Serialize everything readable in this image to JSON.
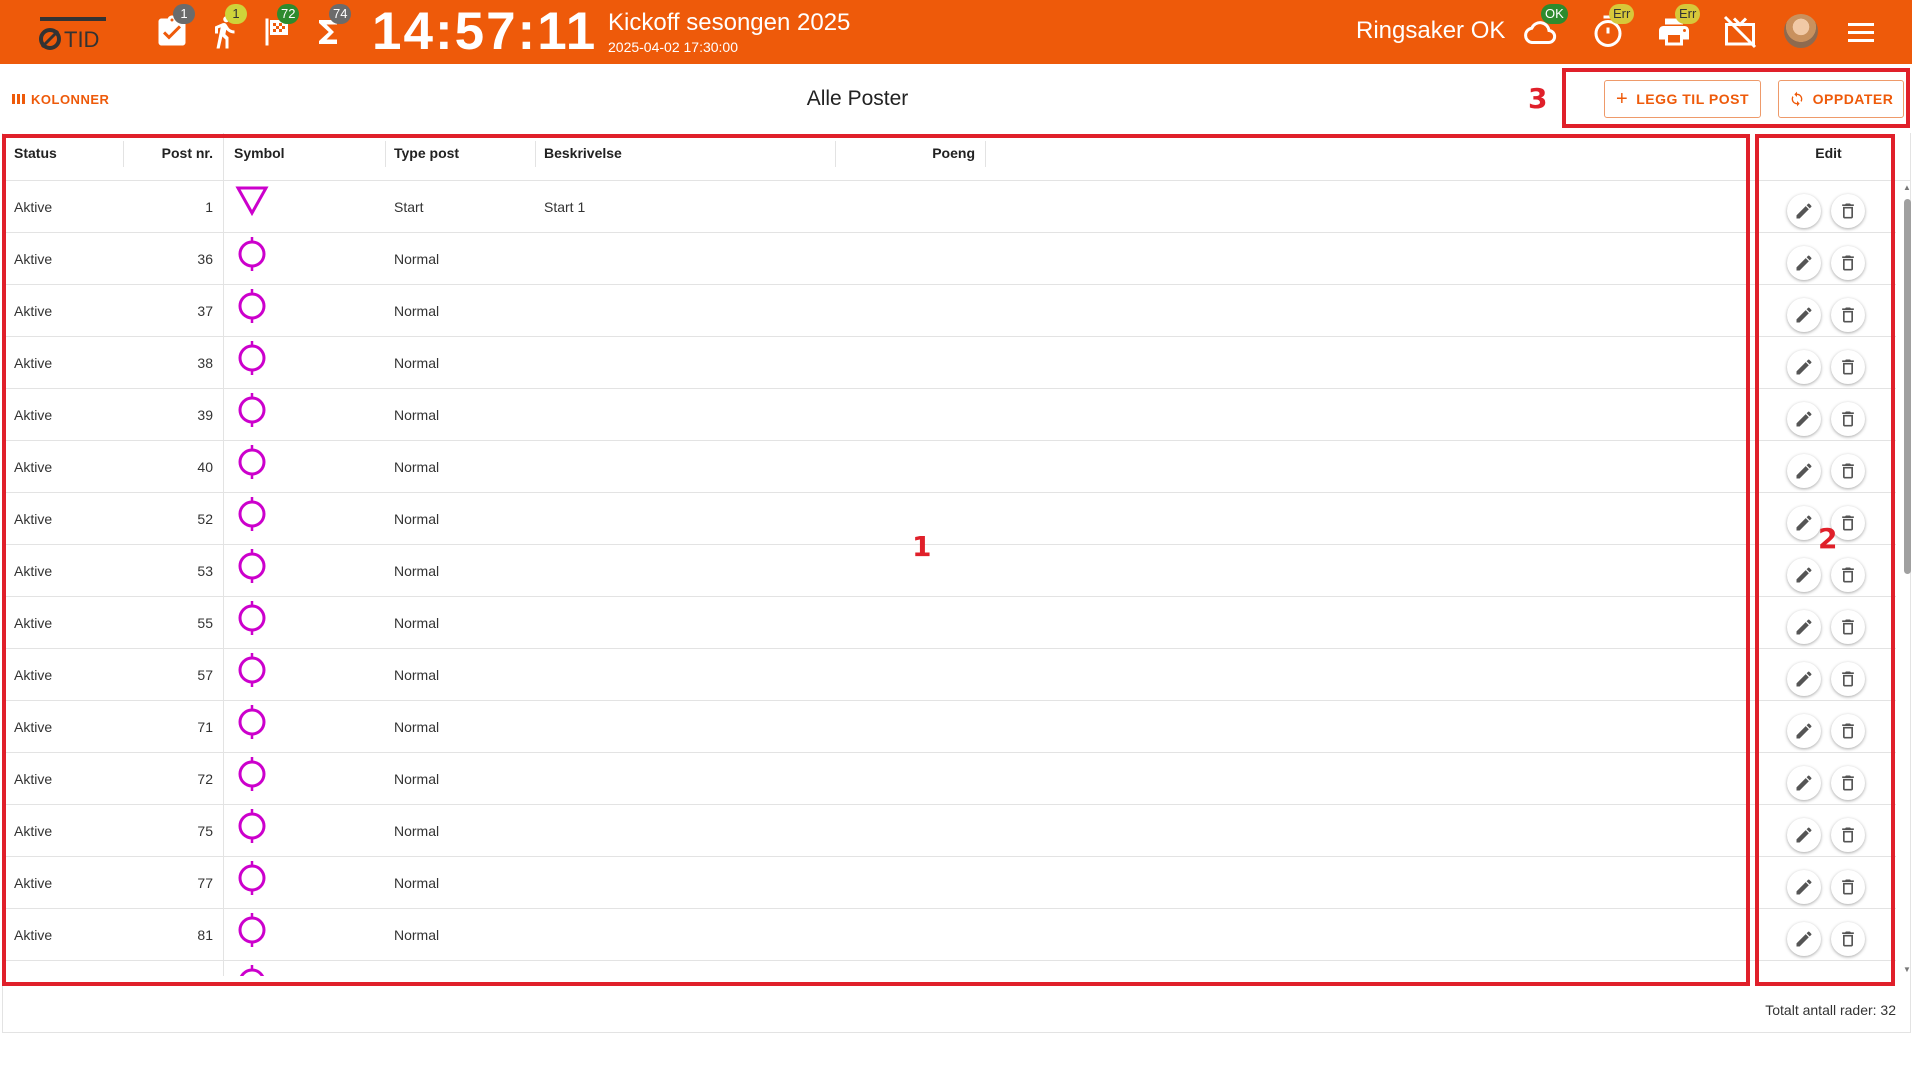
{
  "header": {
    "clock": "14:57:11",
    "event_title": "Kickoff sesongen 2025",
    "event_date": "2025-04-02 17:30:00",
    "club": "Ringsaker OK",
    "badges": {
      "tasks": "1",
      "runners": "1",
      "finish": "72",
      "total": "74",
      "cloud": "OK",
      "timer": "Err",
      "printer": "Err"
    }
  },
  "toolbar": {
    "columns_label": "KOLONNER",
    "page_title": "Alle Poster",
    "add_label": "LEGG TIL POST",
    "refresh_label": "OPPDATER"
  },
  "columns": {
    "status": "Status",
    "post_nr": "Post nr.",
    "symbol": "Symbol",
    "type": "Type post",
    "description": "Beskrivelse",
    "points": "Poeng",
    "edit": "Edit"
  },
  "rows": [
    {
      "status": "Aktive",
      "post_nr": "1",
      "symbol": "start-triangle",
      "type": "Start",
      "description": "Start 1"
    },
    {
      "status": "Aktive",
      "post_nr": "36",
      "symbol": "control-circle",
      "type": "Normal",
      "description": ""
    },
    {
      "status": "Aktive",
      "post_nr": "37",
      "symbol": "control-circle",
      "type": "Normal",
      "description": ""
    },
    {
      "status": "Aktive",
      "post_nr": "38",
      "symbol": "control-circle",
      "type": "Normal",
      "description": ""
    },
    {
      "status": "Aktive",
      "post_nr": "39",
      "symbol": "control-circle",
      "type": "Normal",
      "description": ""
    },
    {
      "status": "Aktive",
      "post_nr": "40",
      "symbol": "control-circle",
      "type": "Normal",
      "description": ""
    },
    {
      "status": "Aktive",
      "post_nr": "52",
      "symbol": "control-circle",
      "type": "Normal",
      "description": ""
    },
    {
      "status": "Aktive",
      "post_nr": "53",
      "symbol": "control-circle",
      "type": "Normal",
      "description": ""
    },
    {
      "status": "Aktive",
      "post_nr": "55",
      "symbol": "control-circle",
      "type": "Normal",
      "description": ""
    },
    {
      "status": "Aktive",
      "post_nr": "57",
      "symbol": "control-circle",
      "type": "Normal",
      "description": ""
    },
    {
      "status": "Aktive",
      "post_nr": "71",
      "symbol": "control-circle",
      "type": "Normal",
      "description": ""
    },
    {
      "status": "Aktive",
      "post_nr": "72",
      "symbol": "control-circle",
      "type": "Normal",
      "description": ""
    },
    {
      "status": "Aktive",
      "post_nr": "75",
      "symbol": "control-circle",
      "type": "Normal",
      "description": ""
    },
    {
      "status": "Aktive",
      "post_nr": "77",
      "symbol": "control-circle",
      "type": "Normal",
      "description": ""
    },
    {
      "status": "Aktive",
      "post_nr": "81",
      "symbol": "control-circle",
      "type": "Normal",
      "description": ""
    },
    {
      "status": "",
      "post_nr": "",
      "symbol": "control-circle",
      "type": "",
      "description": ""
    }
  ],
  "footer": {
    "total_rows": "Totalt antall rader: 32"
  },
  "annotations": [
    "1",
    "2",
    "3"
  ],
  "colors": {
    "brand": "#ee5a0a",
    "symbol": "#cc00cc",
    "annotation": "#e0202a"
  }
}
